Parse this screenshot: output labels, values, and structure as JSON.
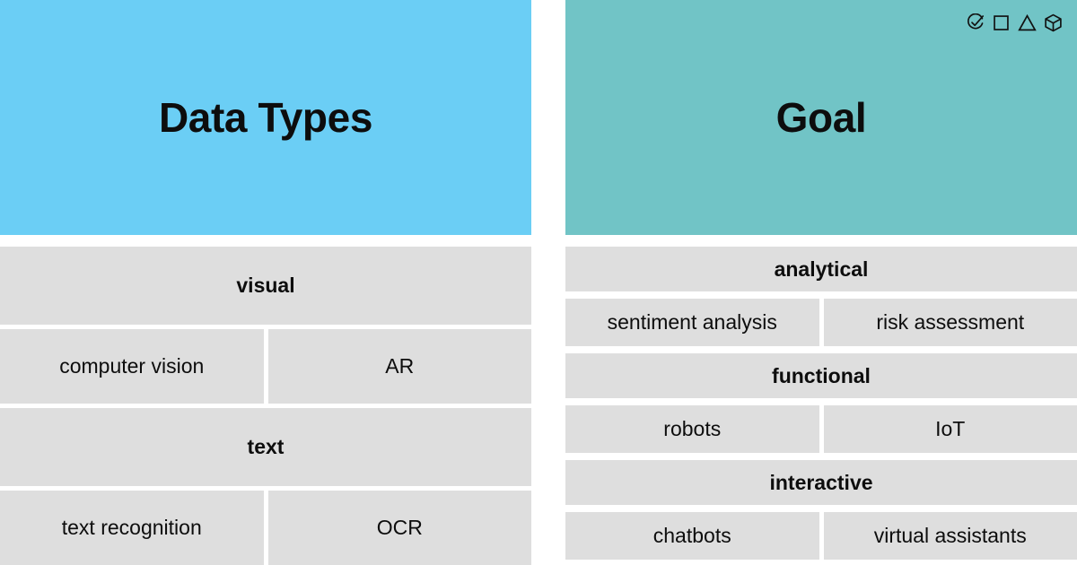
{
  "columns": [
    {
      "id": "data-types",
      "title": "Data Types",
      "header_color": "#6BCEF5",
      "icons": [],
      "groups": [
        {
          "category": "visual",
          "items": [
            "computer vision",
            "AR"
          ]
        },
        {
          "category": "text",
          "items": [
            "text recognition",
            "OCR"
          ]
        }
      ]
    },
    {
      "id": "goal",
      "title": "Goal",
      "header_color": "#71C4C6",
      "icons": [
        "check-circle-icon",
        "square-icon",
        "triangle-icon",
        "cube-icon"
      ],
      "groups": [
        {
          "category": "analytical",
          "items": [
            "sentiment analysis",
            "risk assessment"
          ]
        },
        {
          "category": "functional",
          "items": [
            "robots",
            "IoT"
          ]
        },
        {
          "category": "interactive",
          "items": [
            "chatbots",
            "virtual assistants"
          ]
        }
      ]
    }
  ],
  "palette": {
    "block_gray": "#DEDEDE",
    "text_black": "#0D0D0D",
    "background": "#FFFFFF",
    "blue_header": "#6BCEF5",
    "teal_header": "#71C4C6"
  }
}
